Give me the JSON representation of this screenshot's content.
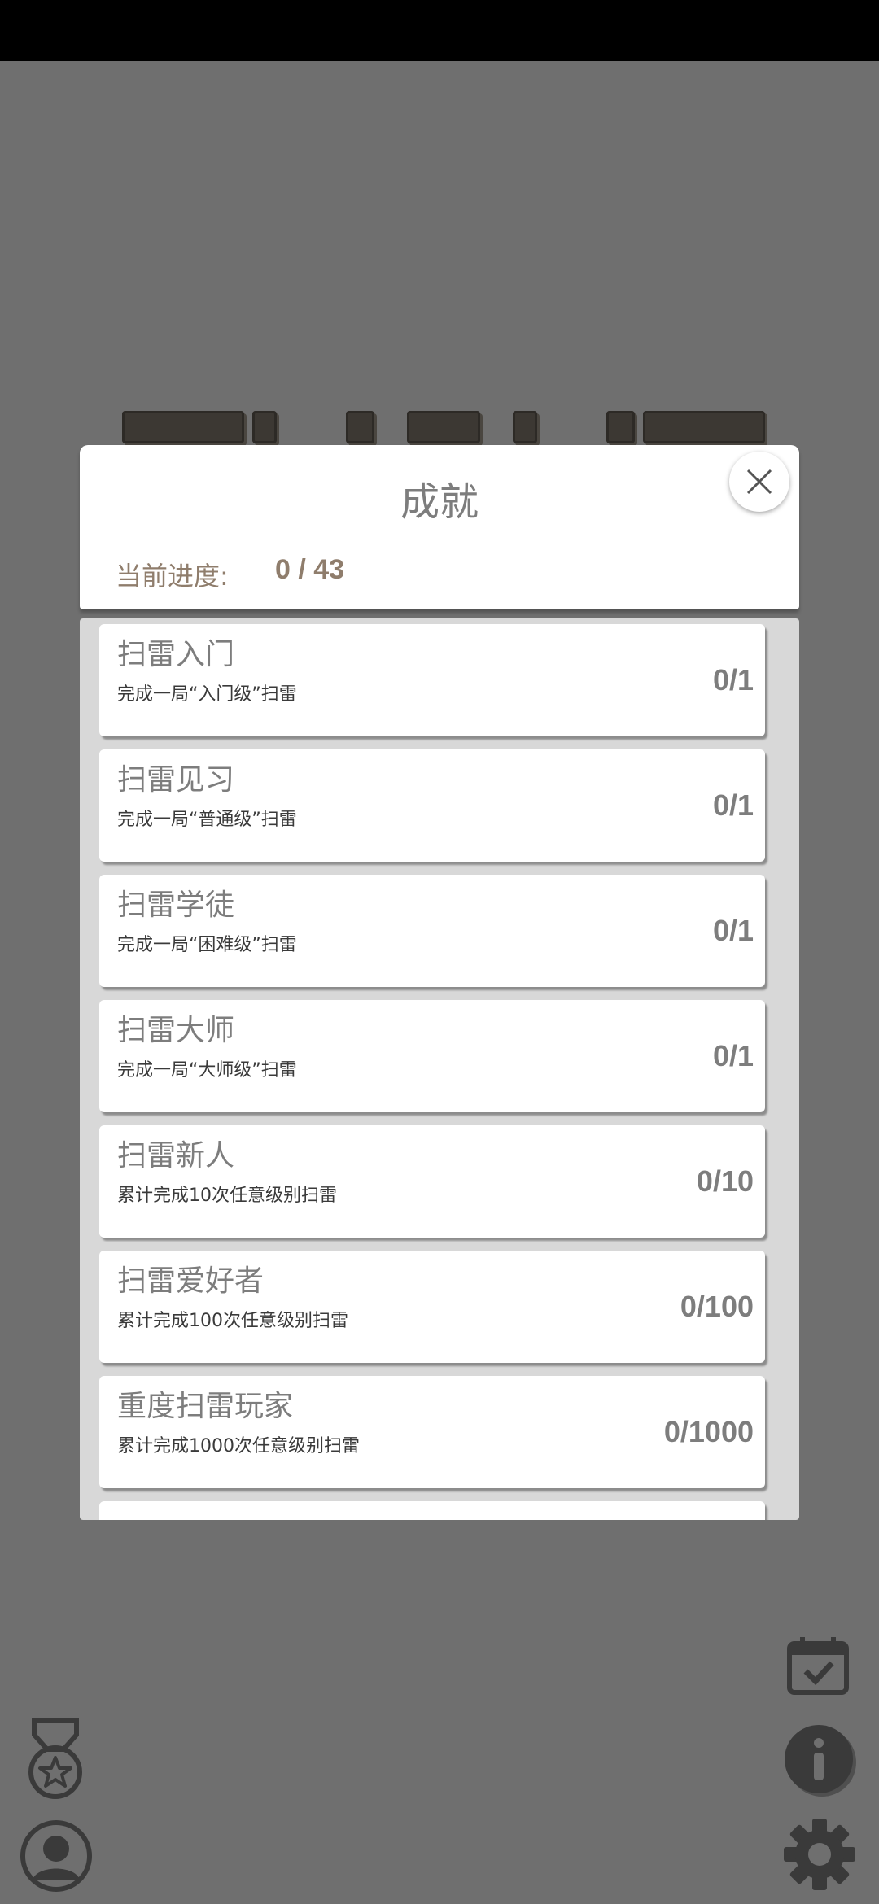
{
  "dialog": {
    "title": "成就",
    "progress_label": "当前进度:",
    "progress_value": "0 / 43"
  },
  "achievements": [
    {
      "title": "扫雷入门",
      "desc": "完成一局“入门级”扫雷",
      "progress": "0/1"
    },
    {
      "title": "扫雷见习",
      "desc": "完成一局“普通级”扫雷",
      "progress": "0/1"
    },
    {
      "title": "扫雷学徒",
      "desc": "完成一局“困难级”扫雷",
      "progress": "0/1"
    },
    {
      "title": "扫雷大师",
      "desc": "完成一局“大师级”扫雷",
      "progress": "0/1"
    },
    {
      "title": "扫雷新人",
      "desc": "累计完成10次任意级别扫雷",
      "progress": "0/10"
    },
    {
      "title": "扫雷爱好者",
      "desc": "累计完成100次任意级别扫雷",
      "progress": "0/100"
    },
    {
      "title": "重度扫雷玩家",
      "desc": "累计完成1000次任意级别扫雷",
      "progress": "0/1000"
    }
  ],
  "icons": {
    "close": "close-icon",
    "calendar": "calendar-check-icon",
    "info": "info-icon",
    "medal": "medal-icon",
    "profile": "profile-icon",
    "settings": "gear-icon"
  },
  "colors": {
    "overlay": "#6f6f6f",
    "accent_text": "#8f7d6c",
    "muted_text": "#7d7d7d",
    "icon_dark": "#3a3a3a"
  }
}
